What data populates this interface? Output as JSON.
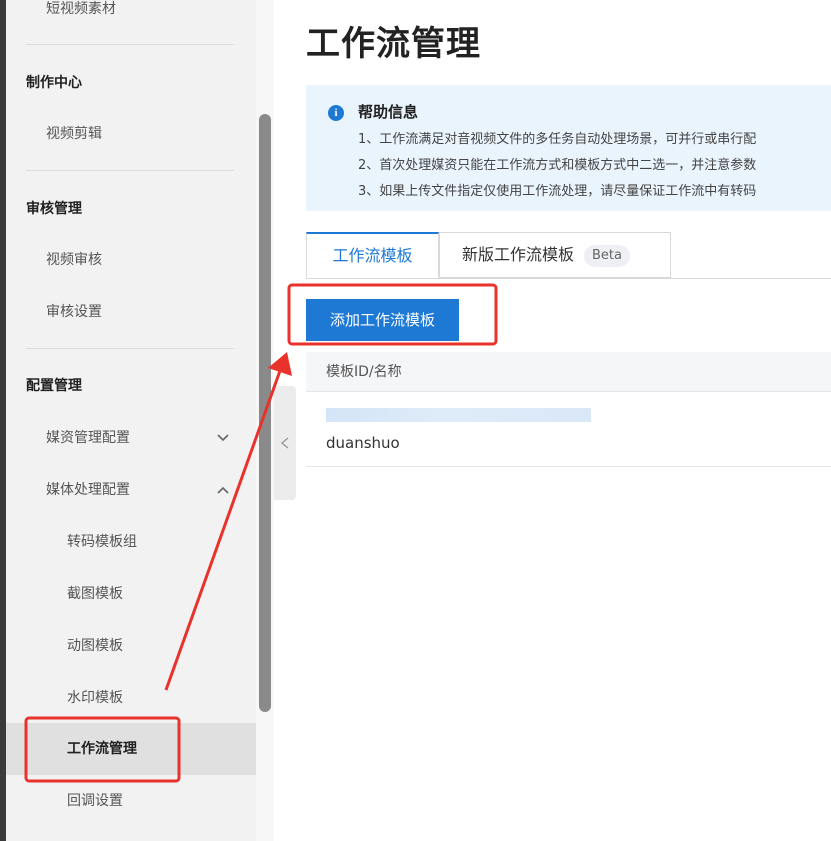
{
  "sidebar": {
    "top_item": "短视频素材",
    "sections": [
      {
        "title": "制作中心",
        "items": [
          "视频剪辑"
        ]
      },
      {
        "title": "审核管理",
        "items": [
          "视频审核",
          "审核设置"
        ]
      },
      {
        "title": "配置管理"
      }
    ],
    "config": {
      "media_asset_config": "媒资管理配置",
      "media_process_config": "媒体处理配置",
      "sub_items": [
        "转码模板组",
        "截图模板",
        "动图模板",
        "水印模板",
        "工作流管理",
        "回调设置"
      ],
      "active_item": "工作流管理"
    }
  },
  "main": {
    "page_title": "工作流管理",
    "help": {
      "title": "帮助信息",
      "lines": [
        "1、工作流满足对音视频文件的多任务自动处理场景，可并行或串行配",
        "2、首次处理媒资只能在工作流方式和模板方式中二选一，并注意参数",
        "3、如果上传文件指定仅使用工作流处理，请尽量保证工作流中有转码"
      ]
    },
    "tabs": [
      {
        "label": "工作流模板",
        "active": true
      },
      {
        "label": "新版工作流模板",
        "badge": "Beta"
      }
    ],
    "add_button": "添加工作流模板",
    "table": {
      "header": "模板ID/名称",
      "rows": [
        {
          "name": "duanshuo"
        }
      ]
    }
  },
  "colors": {
    "accent": "#1e79d4",
    "annotation": "#e8322b",
    "sidebar_bg": "#f2f2f2",
    "help_bg": "#eaf4fd"
  },
  "icons": {
    "help": "info-circle-icon",
    "collapse": "chevron-left-icon",
    "expand": "chevron-down-icon",
    "collapse_group": "chevron-up-icon"
  }
}
